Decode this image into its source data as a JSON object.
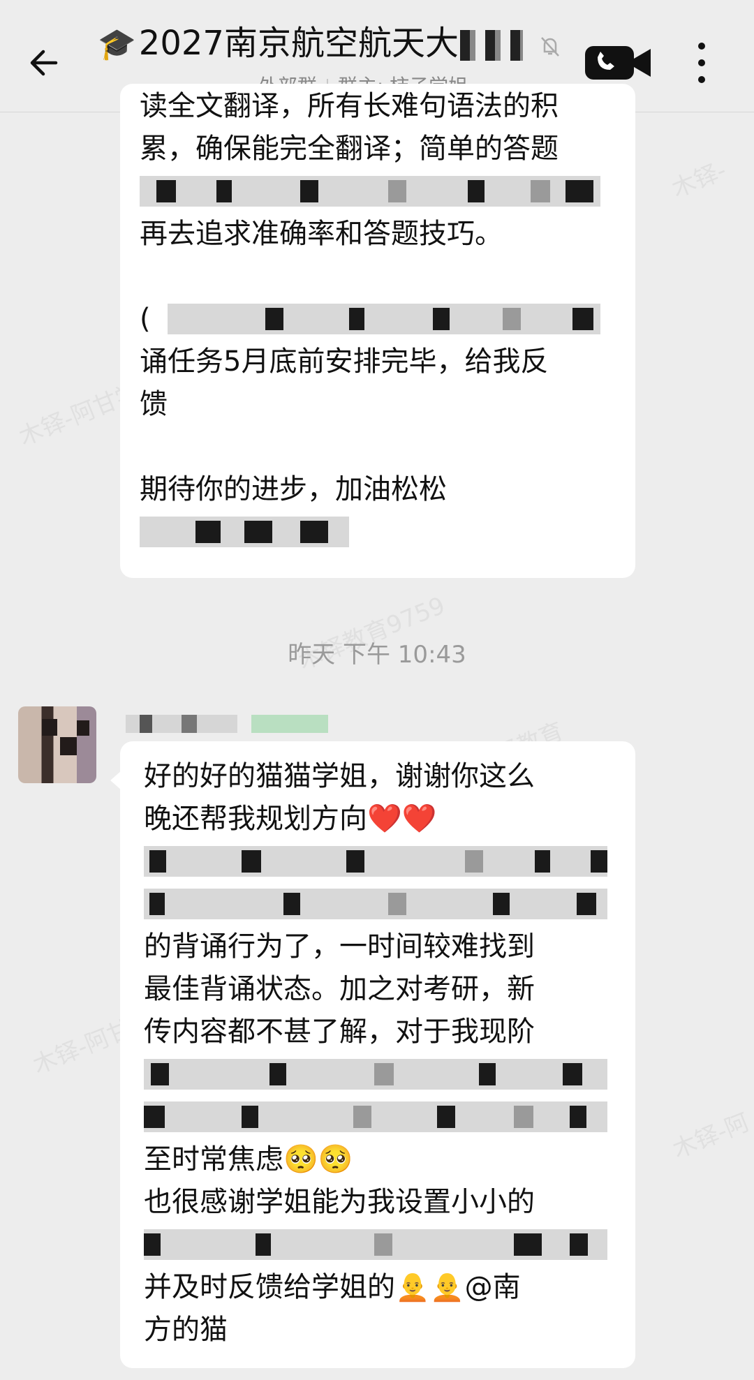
{
  "header": {
    "title": "2027南京航空航天大",
    "title_emoji": "🎓",
    "group_type": "外部群",
    "owner": "群主: 柿子学姐"
  },
  "message1": {
    "lines": [
      "读全文翻译，所有长难句语法的积",
      "累，确保能完全翻译；简单的答题",
      "",
      "再去追求准确率和答题技巧。",
      "",
      "",
      "诵任务5月底前安排完毕，给我反",
      "馈",
      "",
      "期待你的进步，加油松松",
      ""
    ],
    "partial_line_5": "(",
    "partial_line_5b": "）"
  },
  "timestamp": "昨天  下午 10:43",
  "message2": {
    "line1": "好的好的猫猫学姐，谢谢你这么",
    "line2": "晚还帮我规划方向",
    "line2_emoji": "❤️❤️",
    "line5": "的背诵行为了，一时间较难找到",
    "line6": "最佳背诵状态。加之对考研，新",
    "line7": "传内容都不甚了解，对于我现阶",
    "line10": "至时常焦虑",
    "line10_emoji": "🥺🥺",
    "line11": "也很感谢学姐能为我设置小小的",
    "line13": "并及时反馈给学姐的",
    "line13_emoji": "🧑‍🦲🧑‍🦲",
    "line13_tail": "@南",
    "line14": "方的猫"
  },
  "colors": {
    "background": "#ededed",
    "bubble": "#ffffff",
    "muted_text": "#888888"
  }
}
